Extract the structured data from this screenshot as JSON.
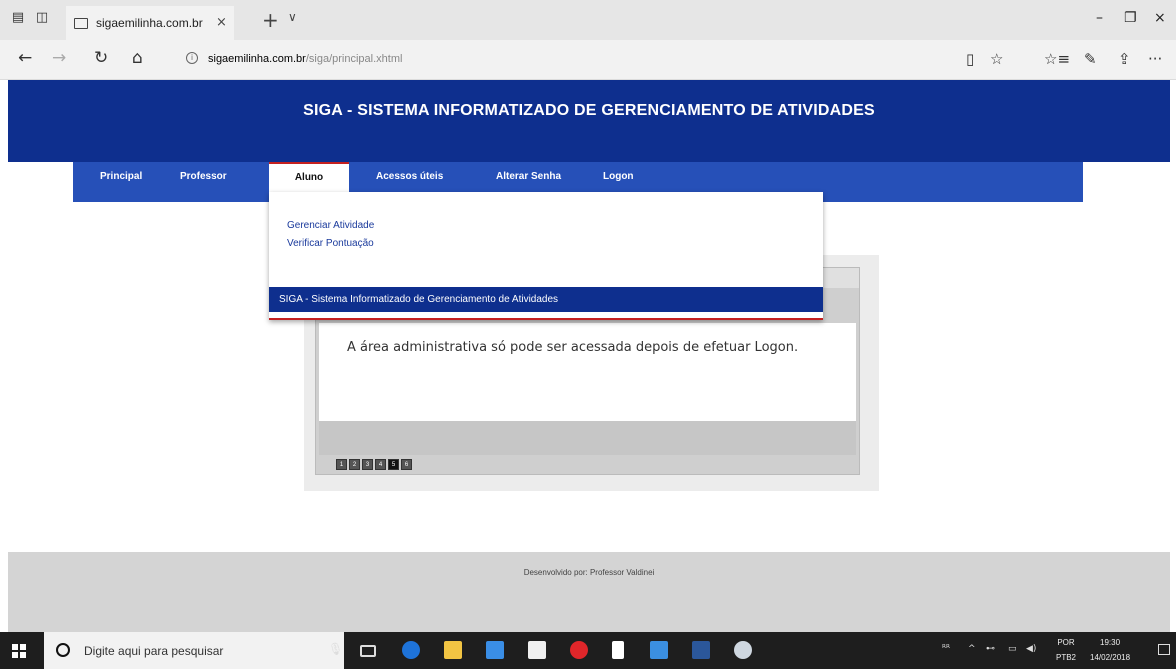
{
  "browser": {
    "tab_title": "sigaemilinha.com.br",
    "tab_close": "×",
    "tab_new": "+",
    "tab_list": "∨",
    "address_host": "sigaemilinha.com.br",
    "address_path": "/siga/principal.xhtml",
    "win_minimize": "–",
    "win_maximize": "❐",
    "win_close": "×",
    "nav": {
      "back": "←",
      "forward": "→",
      "refresh": "↻",
      "home": "⌂"
    },
    "tools": {
      "reading": "▯",
      "favorite": "☆",
      "favorites_hub": "☆≡",
      "notes": "✎",
      "share": "⇪",
      "more": "···"
    }
  },
  "site": {
    "title": "SIGA - SISTEMA INFORMATIZADO DE GERENCIAMENTO DE ATIVIDADES",
    "menu": [
      {
        "label": "Principal"
      },
      {
        "label": "Professor"
      },
      {
        "label": "Aluno"
      },
      {
        "label": "Acessos úteis"
      },
      {
        "label": "Alterar Senha"
      },
      {
        "label": "Logon"
      }
    ],
    "active_menu": "Aluno",
    "dropdown": {
      "links": [
        "Gerenciar Atividade",
        "Verificar Pontuação"
      ],
      "banner": "SIGA - Sistema Informatizado de Gerenciamento de Atividades"
    },
    "slider": {
      "message": "A área administrativa só pode ser acessada depois de efetuar Logon.",
      "pages": [
        "1",
        "2",
        "3",
        "4",
        "5",
        "6"
      ],
      "selected_page": "5"
    },
    "footer": "Desenvolvido por: Professor Valdinei"
  },
  "taskbar": {
    "search_placeholder": "Digite aqui para pesquisar",
    "mic": "🎤",
    "lang_top": "POR",
    "lang_bottom": "PTB2",
    "time": "19:30",
    "date": "14/02/2018",
    "tray_text": "ᴿ ^ ⁽⁾ ◁ ◀)",
    "icon_colors": {
      "edge": "#1e73d9",
      "explorer": "#f2c443",
      "store": "#3a8ee6",
      "mail": "#1e73d9",
      "opera": "#e0262a",
      "notes": "#ffffff",
      "app": "#3b8fe0",
      "word": "#2b579a",
      "paint": "#cfd7e0"
    }
  },
  "colors": {
    "header_bg": "#0e2f8e",
    "menu_bg": "#2650b8",
    "accent_red": "#c42020"
  }
}
